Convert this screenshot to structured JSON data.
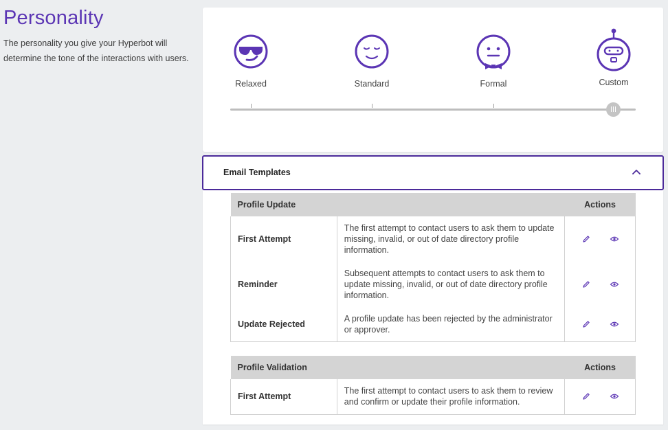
{
  "page": {
    "title": "Personality",
    "description": "The personality you give your Hyperbot will determine the tone of the interactions with users."
  },
  "personality": {
    "options": [
      {
        "label": "Relaxed",
        "icon": "sunglasses-face-icon"
      },
      {
        "label": "Standard",
        "icon": "content-face-icon"
      },
      {
        "label": "Formal",
        "icon": "bowtie-face-icon"
      },
      {
        "label": "Custom",
        "icon": "robot-face-icon"
      }
    ],
    "selected": "Custom",
    "selected_index": 3
  },
  "email_templates": {
    "title": "Email Templates",
    "expanded": true,
    "accent_color": "#4b2a9a",
    "groups": [
      {
        "name": "Profile Update",
        "actions_header": "Actions",
        "rows": [
          {
            "name": "First Attempt",
            "description": "The first attempt to contact users to ask them to update missing, invalid, or out of date directory profile information."
          },
          {
            "name": "Reminder",
            "description": "Subsequent attempts to contact users to ask them to update missing, invalid, or out of date directory profile information."
          },
          {
            "name": "Update Rejected",
            "description": "A profile update has been rejected by the administrator or approver."
          }
        ]
      },
      {
        "name": "Profile Validation",
        "actions_header": "Actions",
        "rows": [
          {
            "name": "First Attempt",
            "description": "The first attempt to contact users to ask them to review and confirm or update their profile information."
          }
        ]
      }
    ]
  },
  "colors": {
    "brand_purple": "#5b35b4",
    "background": "#eceef0"
  }
}
